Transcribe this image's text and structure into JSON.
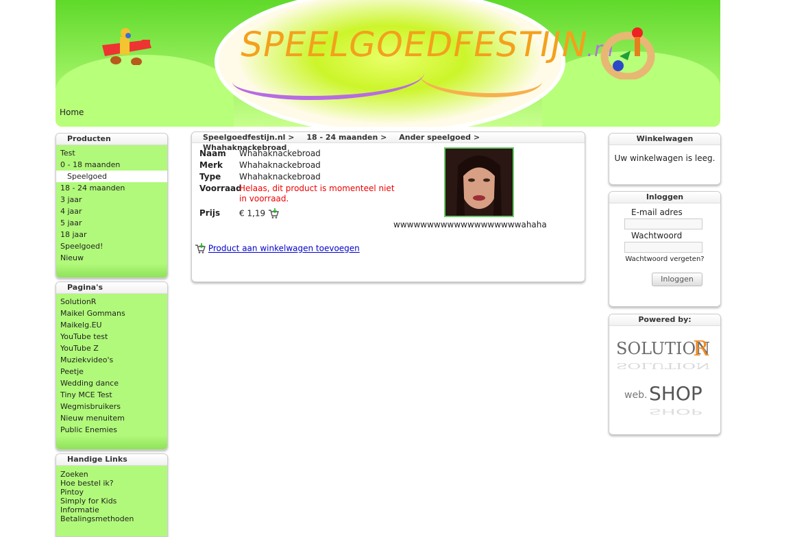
{
  "header": {
    "logo_main": "SPEELGOEDFESTIJN",
    "logo_suffix": ".nl",
    "home_label": "Home"
  },
  "products_box": {
    "title": "Producten",
    "items": [
      "Test",
      "0 - 18 maanden",
      "Speelgoed",
      "18 - 24 maanden",
      "3 jaar",
      "4 jaar",
      "5 jaar",
      "18 jaar",
      "Speelgoed!",
      "Nieuw"
    ],
    "active": "Speelgoed"
  },
  "pages_box": {
    "title": "Pagina's",
    "items": [
      "SolutionR",
      "Maikel Gommans",
      "Maikelg.EU",
      "YouTube test",
      "YouTube Z",
      "Muziekvideo's",
      "Peetje",
      "Wedding dance",
      "Tiny MCE Test",
      "Wegmisbruikers",
      "Nieuw menuitem",
      "Public Enemies"
    ]
  },
  "links_box": {
    "title": "Handige Links",
    "items": [
      "Zoeken",
      "Hoe bestel ik?",
      "Pintoy",
      "Simply for Kids",
      "Informatie",
      "Betalingsmethoden"
    ]
  },
  "breadcrumb": [
    "Speelgoedfestijn.nl  >",
    "18 - 24 maanden  >",
    "Ander speelgoed  >",
    "Whahaknackebroad"
  ],
  "product": {
    "naam_label": "Naam",
    "naam": "Whahaknackebroad",
    "merk_label": "Merk",
    "merk": "Whahaknackebroad",
    "type_label": "Type",
    "type": "Whahaknackebroad",
    "voorraad_label": "Voorraad",
    "voorraad": "Helaas, dit product is momenteel niet in voorraad.",
    "prijs_label": "Prijs",
    "prijs": "€ 1,19",
    "caption": "wwwwwwwwwwwwwwwwwwwahaha",
    "add_link": "Product aan winkelwagen toevoegen"
  },
  "cart_box": {
    "title": "Winkelwagen",
    "text": "Uw winkelwagen is leeg."
  },
  "login_box": {
    "title": "Inloggen",
    "email_label": "E-mail adres",
    "password_label": "Wachtwoord",
    "forgot": "Wachtwoord vergeten?",
    "button": "Inloggen"
  },
  "powered_box": {
    "title": "Powered by:",
    "brand1": "SolutionR",
    "brand2": "web.shop"
  },
  "colors": {
    "green": "#b1f97a",
    "stock_red": "#e00000",
    "link_blue": "#0000cc"
  }
}
